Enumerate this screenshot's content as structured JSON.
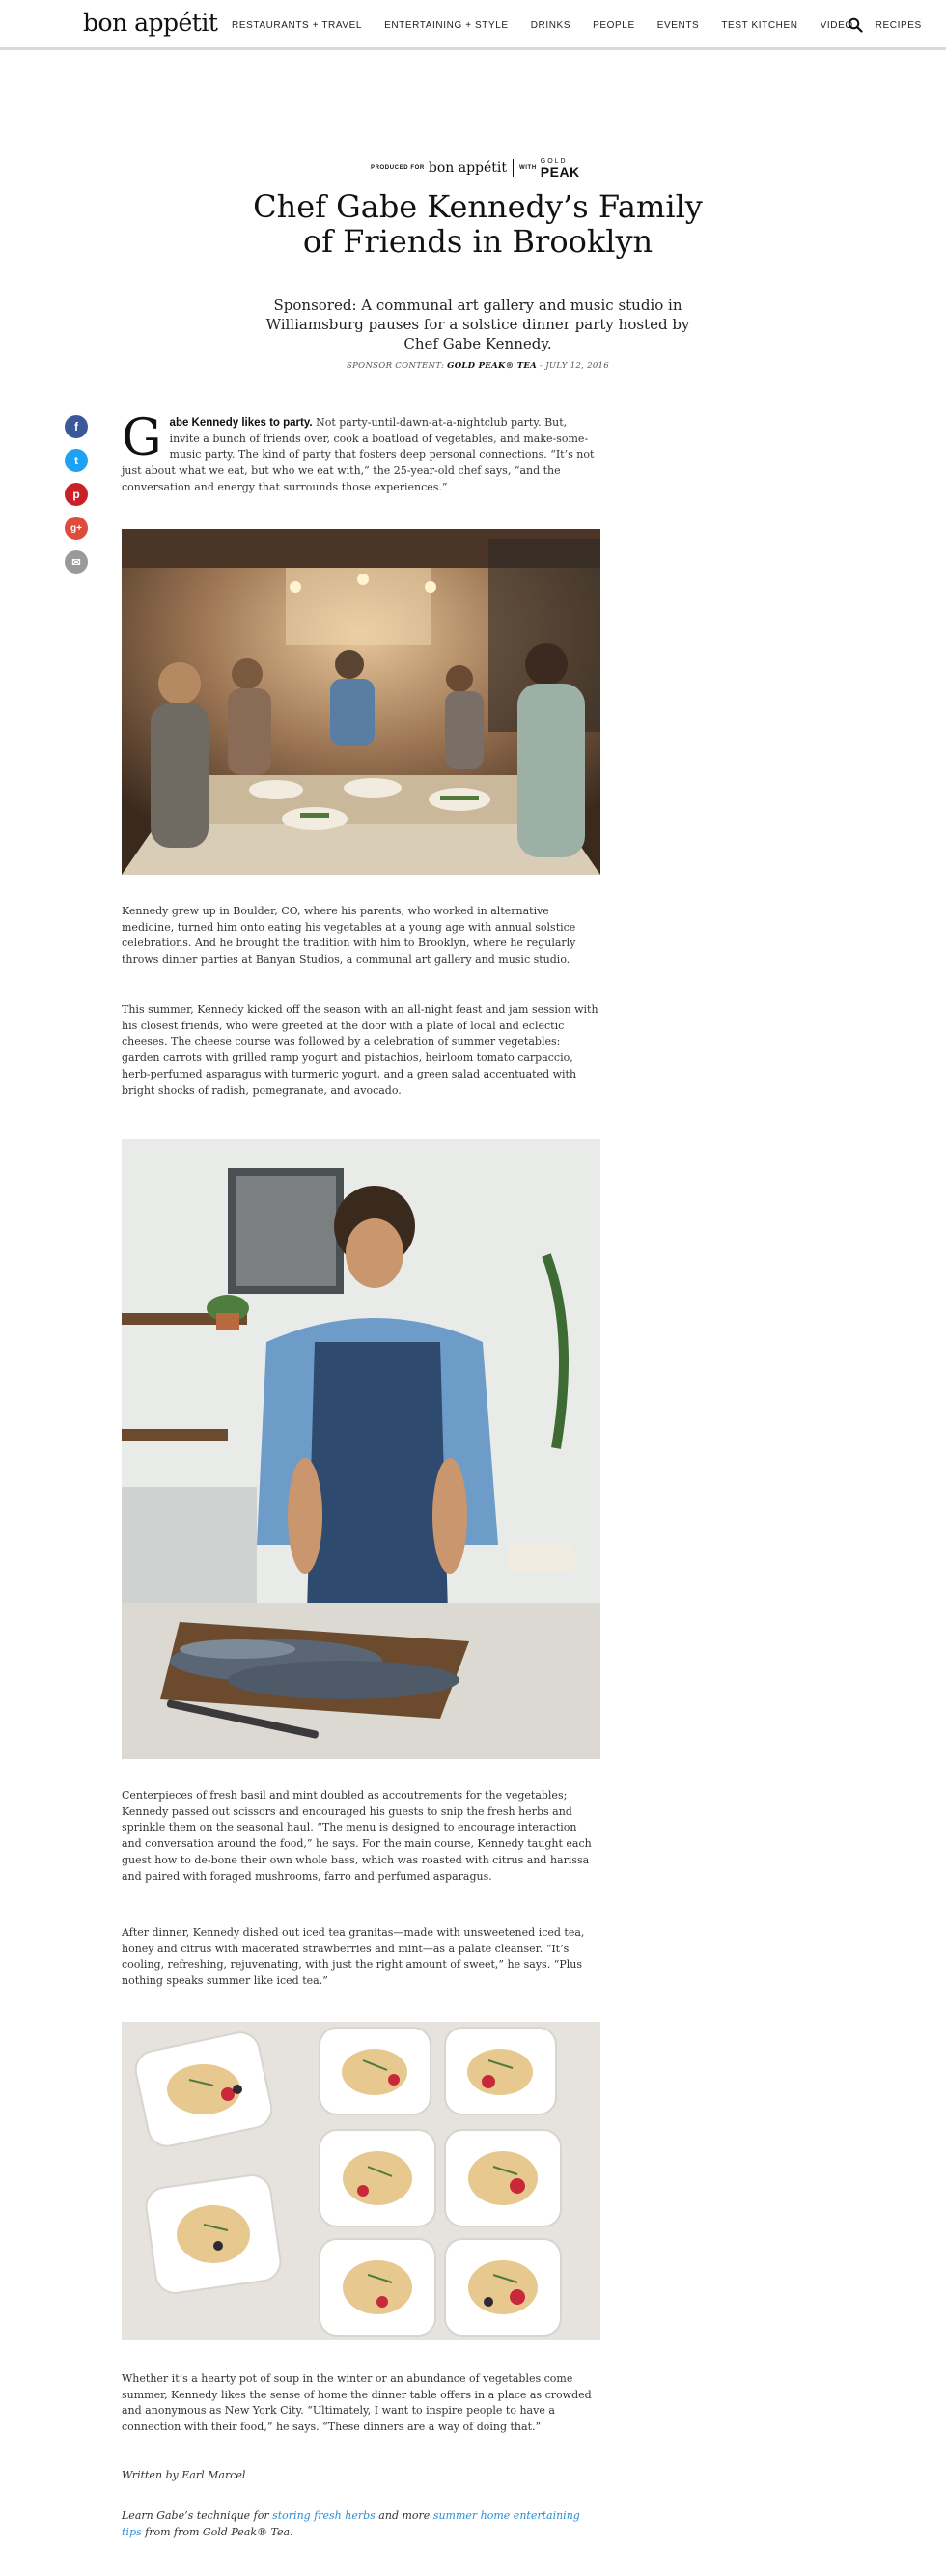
{
  "header": {
    "logo": "bon appétit",
    "nav": [
      "RESTAURANTS + TRAVEL",
      "ENTERTAINING + STYLE",
      "DRINKS",
      "PEOPLE",
      "EVENTS",
      "TEST KITCHEN",
      "VIDEO",
      "RECIPES"
    ],
    "search_icon": "search-icon"
  },
  "sponsor": {
    "produced_for": "PRODUCED FOR",
    "logo": "bon appétit",
    "with": "WITH",
    "brand_top": "GOLD",
    "brand_bottom": "PEAK"
  },
  "article": {
    "title": "Chef Gabe Kennedy’s Family of Friends in Brooklyn",
    "dek": "Sponsored: A communal art gallery and music studio in Williamsburg pauses for a solstice dinner party hosted by Chef Gabe Kennedy.",
    "meta_prefix": "SPONSOR CONTENT:",
    "meta_sponsor": "GOLD PEAK® TEA",
    "meta_date": "- JULY 12, 2016",
    "dropcap": "G",
    "lead_bold": "abe Kennedy likes to party.",
    "p1": " Not party-until-dawn-at-a-nightclub party. But, invite a bunch of friends over, cook a boatload of vegetables, and make-some-music party. The kind of party that fosters deep personal connections. “It’s not just about what we eat, but who we eat with,” the 25-year-old chef says, “and the conversation and energy that surrounds those experiences.”",
    "p2": "Kennedy grew up in Boulder, CO, where his parents, who worked in alternative medicine, turned him onto eating his vegetables at a young age with annual solstice celebrations. And he brought the tradition with him to Brooklyn, where he regularly throws dinner parties at Banyan Studios, a communal art gallery and music studio.",
    "p3": "This summer, Kennedy kicked off the season with an all-night feast and jam session with his closest friends, who were greeted at the door with a plate of local and eclectic cheeses. The cheese course was followed by a celebration of summer vegetables: garden carrots with grilled ramp yogurt and pistachios, heirloom tomato carpaccio, herb-perfumed asparagus with turmeric yogurt, and a green salad accentuated with bright shocks of radish, pomegranate, and avocado.",
    "p4": "Centerpieces of fresh basil and mint doubled as accoutrements for the vegetables; Kennedy passed out scissors and encouraged his guests to snip the fresh herbs and sprinkle them on the seasonal haul. “The menu is designed to encourage interaction and conversation around the food,” he says. For the main course, Kennedy taught each guest how to de-bone their own whole bass, which was roasted with citrus and harissa and paired with foraged mushrooms, farro and perfumed asparagus.",
    "p5": "After dinner, Kennedy dished out iced tea granitas—made with unsweetened iced tea, honey and citrus with macerated strawberries and mint—as a palate cleanser. “It’s cooling, refreshing, rejuvenating, with just the right amount of sweet,” he says. “Plus nothing speaks summer like iced tea.”",
    "p6": "Whether it’s a hearty pot of soup in the winter or an abundance of vegetables come summer, Kennedy likes the sense of home the dinner table offers in a place as crowded and anonymous as New York City. “Ultimately, I want to inspire people to have a connection with their food,” he says. “These dinners are a way of doing that.”",
    "written_by": "Written by Earl Marcel",
    "final_pre": "Learn Gabe’s technique for ",
    "final_link1": "storing fresh herbs",
    "final_mid": " and more ",
    "final_link2": "summer home entertaining tips",
    "final_post": " from from Gold Peak® Tea."
  },
  "share": [
    {
      "name": "facebook",
      "glyph": "f",
      "color": "#3b5998"
    },
    {
      "name": "twitter",
      "glyph": "t",
      "color": "#1da1f2"
    },
    {
      "name": "pinterest",
      "glyph": "p",
      "color": "#cb2027"
    },
    {
      "name": "googleplus",
      "glyph": "g+",
      "color": "#dd4b39"
    },
    {
      "name": "email",
      "glyph": "✉",
      "color": "#9a9a9a"
    }
  ]
}
